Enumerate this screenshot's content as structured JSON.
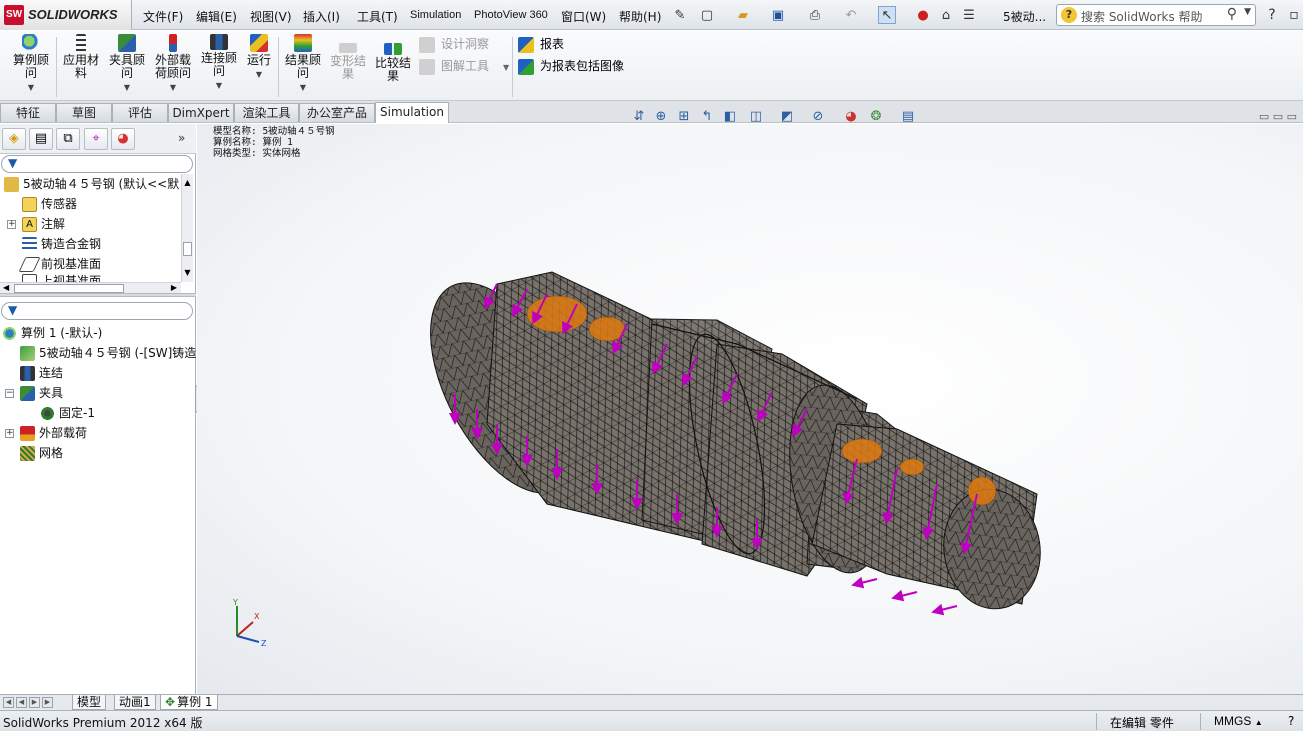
{
  "app": {
    "name": "SOLIDWORKS",
    "logo_mark": "SW"
  },
  "menu": {
    "items": [
      "文件(F)",
      "编辑(E)",
      "视图(V)",
      "插入(I)",
      "工具(T)",
      "Simulation",
      "PhotoView 360",
      "窗口(W)",
      "帮助(H)"
    ],
    "document_title": "5被动...",
    "search_placeholder": "搜索 SolidWorks 帮助",
    "help_icon": "?"
  },
  "commands": {
    "study_advisor": "算例顾问",
    "apply_material": "应用材料",
    "fixtures_advisor": "夹具顾问",
    "external_loads_advisor": "外部载荷顾问",
    "connections_advisor": "连接顾问",
    "run": "运行",
    "results_advisor": "结果顾问",
    "deformed_result": "变形结果",
    "compare_results": "比较结果",
    "design_insight": "设计洞察",
    "plot_tools": "图解工具",
    "report": "报表",
    "include_image": "为报表包括图像"
  },
  "tabs": [
    "特征",
    "草图",
    "评估",
    "DimXpert",
    "渲染工具",
    "办公室产品",
    "Simulation"
  ],
  "active_tab": "Simulation",
  "feature_tree": {
    "root": "5被动轴４５号钢  (默认<<默",
    "items": [
      "传感器",
      "注解",
      "铸造合金钢",
      "前视基准面",
      "上视基准面"
    ]
  },
  "simulation_tree": {
    "study": "算例 1 (-默认-)",
    "part": "5被动轴４５号钢 (-[SW]铸造",
    "connections": "连结",
    "fixtures": "夹具",
    "fixture_1": "固定-1",
    "external_loads": "外部载荷",
    "mesh": "网格"
  },
  "viewport": {
    "info_lines": [
      "模型名称: 5被动轴４５号钢",
      "算例名称: 算例 1",
      "网格类型: 实体网格"
    ],
    "triad": {
      "x": "X",
      "y": "Y",
      "z": "Z"
    }
  },
  "bottom_tabs": [
    "模型",
    "动画1",
    "算例 1"
  ],
  "active_bottom_tab": "算例 1",
  "status": {
    "product": "SolidWorks Premium 2012 x64 版",
    "mode": "在编辑 零件",
    "units": "MMGS"
  },
  "colors": {
    "load_arrow": "#c000c0",
    "fixture": "#e07a10",
    "part": "#7c766f",
    "mesh": "#1a1a1a",
    "tab_active": "#ffffff"
  }
}
